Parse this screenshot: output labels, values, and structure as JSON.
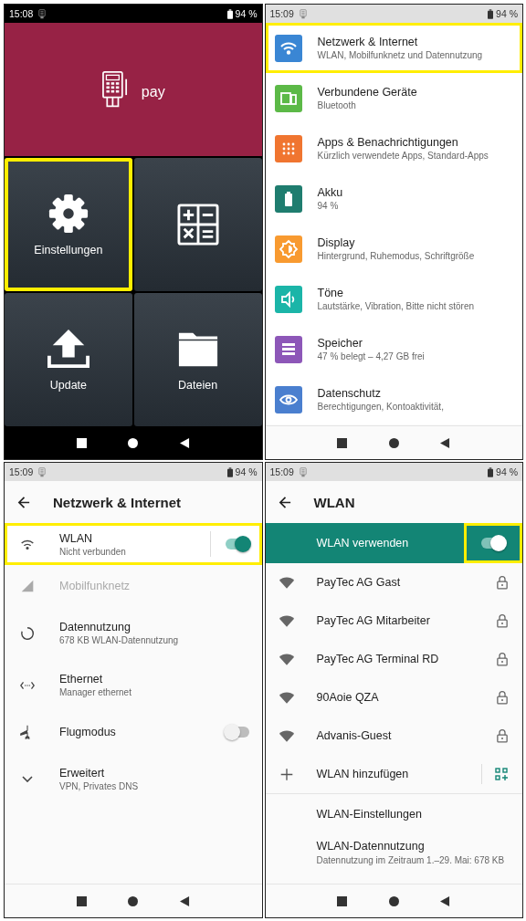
{
  "screens": [
    {
      "kind": "launcher",
      "status": {
        "time": "15:08",
        "battery": "94 %"
      },
      "pay_tile": {
        "label": "pay"
      },
      "tiles": [
        {
          "label": "Einstellungen",
          "highlighted": true
        },
        {
          "highlighted": false
        },
        {
          "label": "Update",
          "highlighted": false
        },
        {
          "label": "Dateien",
          "highlighted": false
        }
      ]
    },
    {
      "kind": "settings_list",
      "status": {
        "time": "15:09",
        "battery": "94 %"
      },
      "items": [
        {
          "title": "Netzwerk & Internet",
          "subtitle": "WLAN, Mobilfunknetz und Datennutzung",
          "color": "#3a86d4",
          "highlighted": true
        },
        {
          "title": "Verbundene Geräte",
          "subtitle": "Bluetooth",
          "color": "#5cb947",
          "highlighted": false
        },
        {
          "title": "Apps & Benachrichtigungen",
          "subtitle": "Kürzlich verwendete Apps, Standard-Apps",
          "color": "#f07530",
          "highlighted": false
        },
        {
          "title": "Akku",
          "subtitle": "94 %",
          "color": "#1f7d6f",
          "highlighted": false
        },
        {
          "title": "Display",
          "subtitle": "Hintergrund, Ruhemodus, Schriftgröße",
          "color": "#f89a30",
          "highlighted": false
        },
        {
          "title": "Töne",
          "subtitle": "Lautstärke, Vibration, Bitte nicht stören",
          "color": "#1bb5a8",
          "highlighted": false
        },
        {
          "title": "Speicher",
          "subtitle": "47 % belegt – 4,27 GB frei",
          "color": "#8d57b8",
          "highlighted": false
        },
        {
          "title": "Datenschutz",
          "subtitle": "Berechtigungen, Kontoaktivität,",
          "color": "#4a7fcf",
          "highlighted": false
        }
      ]
    },
    {
      "kind": "network",
      "status": {
        "time": "15:09",
        "battery": "94 %"
      },
      "title": "Netzwerk & Internet",
      "items": [
        {
          "title": "WLAN",
          "subtitle": "Nicht verbunden",
          "on": true,
          "disabled": false,
          "highlighted": true
        },
        {
          "title": "Mobilfunknetz",
          "disabled": true,
          "highlighted": false
        },
        {
          "title": "Datennutzung",
          "subtitle": "678 KB WLAN-Datennutzung",
          "disabled": false,
          "highlighted": false
        },
        {
          "title": "Ethernet",
          "subtitle": "Manager ethernet",
          "disabled": false,
          "highlighted": false
        },
        {
          "title": "Flugmodus",
          "on": false,
          "disabled": false,
          "highlighted": false
        },
        {
          "title": "Erweitert",
          "subtitle": "VPN, Privates DNS",
          "disabled": false,
          "highlighted": false
        }
      ]
    },
    {
      "kind": "wlan",
      "status": {
        "time": "15:09",
        "battery": "94 %"
      },
      "title": "WLAN",
      "master": {
        "label": "WLAN verwenden",
        "on": true,
        "highlighted": true
      },
      "networks": [
        {
          "name": "PayTec AG Gast",
          "locked": true
        },
        {
          "name": "PayTec AG Mitarbeiter",
          "locked": true
        },
        {
          "name": "PayTec AG Terminal RD",
          "locked": true
        },
        {
          "name": "90Aoie QZA",
          "locked": true
        },
        {
          "name": "Advanis-Guest",
          "locked": true
        }
      ],
      "add_label": "WLAN hinzufügen",
      "links": [
        {
          "title": "WLAN-Einstellungen"
        },
        {
          "title": "WLAN-Datennutzung",
          "subtitle": "Datennutzung im Zeitraum 1.–29. Mai: 678 KB"
        }
      ]
    }
  ]
}
